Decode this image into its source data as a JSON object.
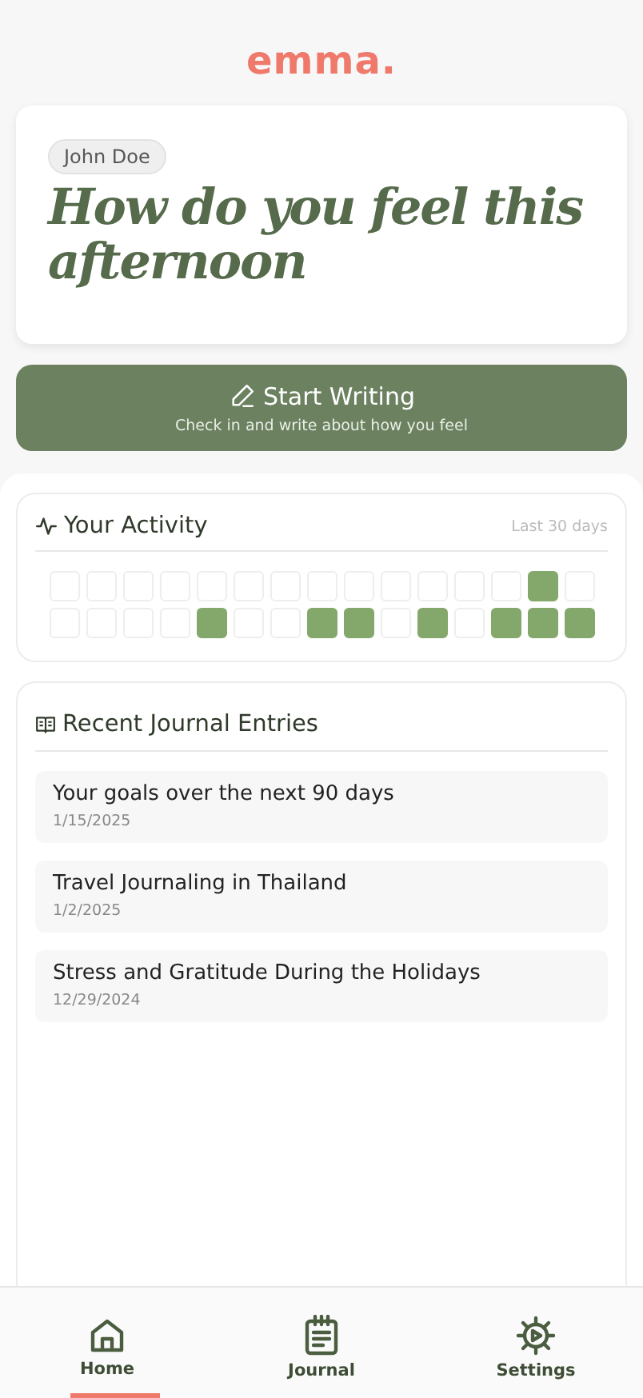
{
  "logo": "emma.",
  "greeting": {
    "user": "John Doe",
    "title": "How do you feel this afternoon"
  },
  "start_button": {
    "label": "Start Writing",
    "subtitle": "Check in and write about how you feel"
  },
  "activity": {
    "title": "Your Activity",
    "range": "Last 30 days",
    "days": [
      {
        "active": false
      },
      {
        "active": false
      },
      {
        "active": false
      },
      {
        "active": false
      },
      {
        "active": false
      },
      {
        "active": false
      },
      {
        "active": false
      },
      {
        "active": false
      },
      {
        "active": false
      },
      {
        "active": false
      },
      {
        "active": false
      },
      {
        "active": false
      },
      {
        "active": false
      },
      {
        "active": true
      },
      {
        "active": false
      },
      {
        "active": false
      },
      {
        "active": false
      },
      {
        "active": false
      },
      {
        "active": false
      },
      {
        "active": true
      },
      {
        "active": false
      },
      {
        "active": false
      },
      {
        "active": true
      },
      {
        "active": true
      },
      {
        "active": false
      },
      {
        "active": true
      },
      {
        "active": false
      },
      {
        "active": true
      },
      {
        "active": true
      },
      {
        "active": true
      }
    ]
  },
  "journal": {
    "title": "Recent Journal Entries",
    "entries": [
      {
        "title": "Your goals over the next 90 days",
        "date": "1/15/2025"
      },
      {
        "title": "Travel Journaling in Thailand",
        "date": "1/2/2025"
      },
      {
        "title": "Stress and Gratitude During the Holidays",
        "date": "12/29/2024"
      }
    ]
  },
  "nav": [
    {
      "label": "Home",
      "kind": "home",
      "selected": true
    },
    {
      "label": "Journal",
      "kind": "journal",
      "selected": false
    },
    {
      "label": "Settings",
      "kind": "settings",
      "selected": false
    }
  ]
}
